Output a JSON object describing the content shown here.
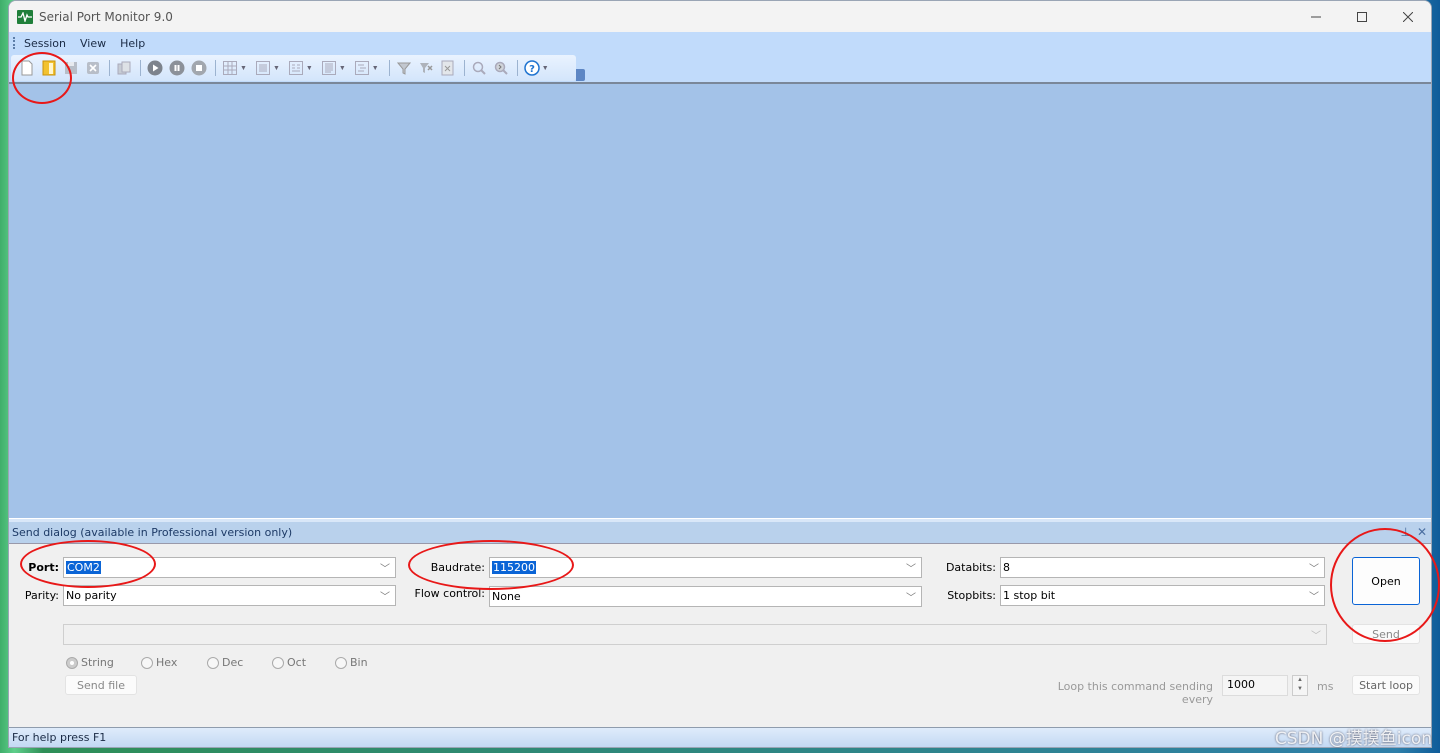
{
  "window": {
    "title": "Serial Port Monitor 9.0",
    "controls": [
      "minimize",
      "maximize",
      "close"
    ]
  },
  "menu": {
    "items": [
      {
        "label": "Session"
      },
      {
        "label": "View"
      },
      {
        "label": "Help"
      }
    ]
  },
  "toolbar": {
    "buttons": [
      {
        "icon": "new-session-icon"
      },
      {
        "icon": "open-session-icon"
      },
      {
        "icon": "save-icon"
      },
      {
        "icon": "close-session-icon"
      },
      {
        "icon": "copy-icon"
      },
      {
        "icon": "play-icon"
      },
      {
        "icon": "pause-icon"
      },
      {
        "icon": "stop-icon"
      },
      {
        "icon": "table-view-icon"
      },
      {
        "icon": "line-view-icon"
      },
      {
        "icon": "dump-view-icon"
      },
      {
        "icon": "terminal-view-icon"
      },
      {
        "icon": "modbus-view-icon"
      },
      {
        "icon": "filter-icon"
      },
      {
        "icon": "filter-settings-icon"
      },
      {
        "icon": "clear-icon"
      },
      {
        "icon": "search-icon"
      },
      {
        "icon": "find-next-icon"
      },
      {
        "icon": "help-icon"
      }
    ]
  },
  "send_dialog": {
    "title": "Send dialog (available in Professional version only)",
    "port_label": "Port:",
    "port_value": "COM2",
    "parity_label": "Parity:",
    "parity_value": "No parity",
    "baudrate_label": "Baudrate:",
    "baudrate_value": "115200",
    "flow_label": "Flow control:",
    "flow_value": "None",
    "databits_label": "Databits:",
    "databits_value": "8",
    "stopbits_label": "Stopbits:",
    "stopbits_value": "1 stop bit",
    "open_label": "Open",
    "command_value": "",
    "send_label": "Send",
    "formats": [
      {
        "label": "String",
        "selected": true
      },
      {
        "label": "Hex",
        "selected": false
      },
      {
        "label": "Dec",
        "selected": false
      },
      {
        "label": "Oct",
        "selected": false
      },
      {
        "label": "Bin",
        "selected": false
      }
    ],
    "send_file_label": "Send file",
    "loop_label": "Loop this command sending every",
    "loop_value": "1000",
    "loop_unit": "ms",
    "start_loop_label": "Start loop"
  },
  "status": {
    "text": "For help press F1"
  },
  "watermark": "CSDN @摸摸鱼icon"
}
